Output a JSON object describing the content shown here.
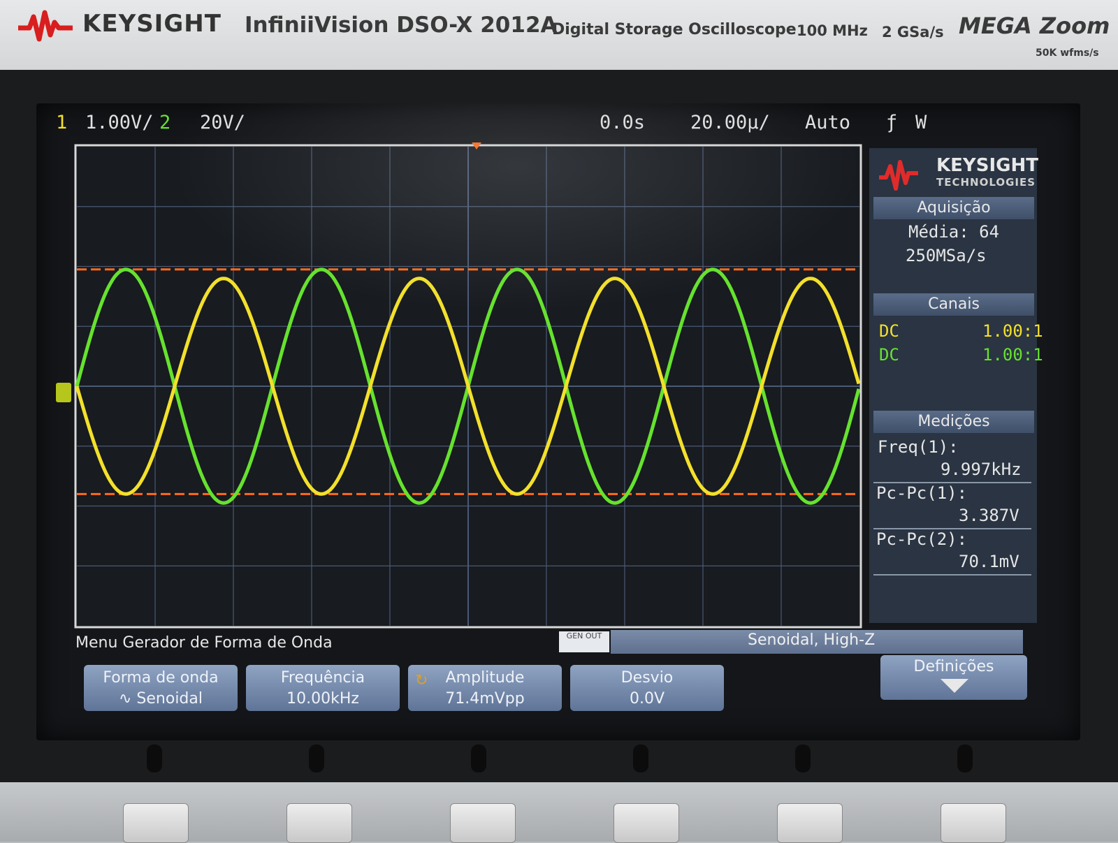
{
  "header": {
    "brand": "KEYSIGHT",
    "model": "InfiniiVision DSO-X 2012A",
    "description": "Digital Storage Oscilloscope",
    "bandwidth": "100 MHz",
    "sample_rate": "2 GSa/s",
    "megazoom": "MEGA Zoom",
    "megazoom_sub": "50K wfms/s"
  },
  "status_bar": {
    "ch1_number": "1",
    "ch1_scale": "1.00V/",
    "ch2_number": "2",
    "ch2_scale": "20V/",
    "time_position": "0.0s",
    "time_scale": "20.00µ/",
    "trigger_mode": "Auto",
    "trigger_icon": "ƒ",
    "trigger_channel": "W"
  },
  "colors": {
    "ch1": "#f3e02b",
    "ch2": "#66e22e",
    "cursor": "#ff6a1a",
    "grid": "#4a5a74"
  },
  "waveforms": {
    "ch1_peak_to_peak_divs": 3.6,
    "ch2_peak_to_peak_divs": 3.9,
    "cycles_on_screen": 4.0,
    "phase_relation": "ch2 leads ch1 by 180 deg"
  },
  "right_panel": {
    "brand": "KEYSIGHT",
    "brand_sub": "TECHNOLOGIES",
    "acquisition": {
      "header": "Aquisição",
      "mode": "Média: 64",
      "rate": "250MSa/s"
    },
    "channels": {
      "header": "Canais",
      "rows": [
        {
          "coupling": "DC",
          "ratio": "1.00:1"
        },
        {
          "coupling": "DC",
          "ratio": "1.00:1"
        }
      ]
    },
    "measurements": {
      "header": "Medições",
      "items": [
        {
          "label": "Freq(1):",
          "value": "9.997kHz"
        },
        {
          "label": "Pc-Pc(1):",
          "value": "3.387V"
        },
        {
          "label": "Pc-Pc(2):",
          "value": "70.1mV"
        }
      ]
    }
  },
  "menu": {
    "title": "Menu Gerador de Forma de Onda",
    "gen_out": "GEN OUT",
    "wave_status": "Senoidal, High-Z",
    "softkeys": [
      {
        "label": "Forma de onda",
        "value": "∿ Senoidal"
      },
      {
        "label": "Frequência",
        "value": "10.00kHz"
      },
      {
        "label": "Amplitude",
        "value": "71.4mVpp"
      },
      {
        "label": "Desvio",
        "value": "0.0V"
      }
    ],
    "settings_label": "Definições"
  }
}
